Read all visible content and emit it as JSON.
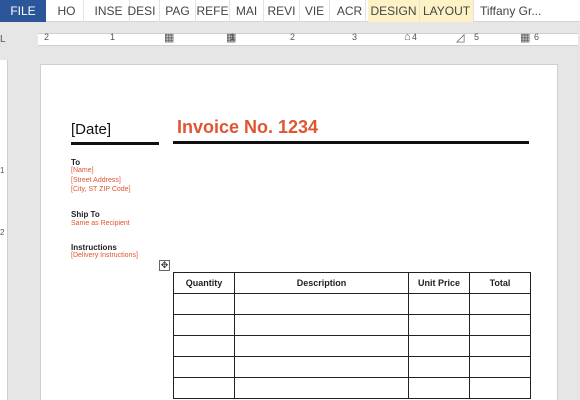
{
  "ribbon": {
    "tabs": [
      {
        "label": "FILE"
      },
      {
        "label": "HO"
      },
      {
        "label": "INSE"
      },
      {
        "label": "DESI"
      },
      {
        "label": "PAG"
      },
      {
        "label": "REFE"
      },
      {
        "label": "MAI"
      },
      {
        "label": "REVI"
      },
      {
        "label": "VIE"
      },
      {
        "label": "ACR"
      },
      {
        "label": "DESIGN"
      },
      {
        "label": "LAYOUT"
      }
    ],
    "user": "Tiffany Gr..."
  },
  "ruler": {
    "numbers": [
      "2",
      "1",
      "1",
      "2",
      "3",
      "4",
      "5",
      "6"
    ],
    "vertical_numbers": [
      "1",
      "2"
    ]
  },
  "document": {
    "date": "[Date]",
    "invoice_title": "Invoice No. 1234",
    "to": {
      "label": "To",
      "name": "[Name]",
      "street": "[Street Address]",
      "city": "[City, ST  ZIP Code]"
    },
    "ship_to": {
      "label": "Ship To",
      "value": "Same as Recipient"
    },
    "instructions": {
      "label": "Instructions",
      "value": "[Delivery Instructions]"
    },
    "table": {
      "headers": [
        "Quantity",
        "Description",
        "Unit Price",
        "Total"
      ],
      "row_count": 5
    }
  },
  "colors": {
    "accent": "#e05532",
    "file_tab": "#2b579a",
    "context_tab": "#fdf2c5"
  }
}
